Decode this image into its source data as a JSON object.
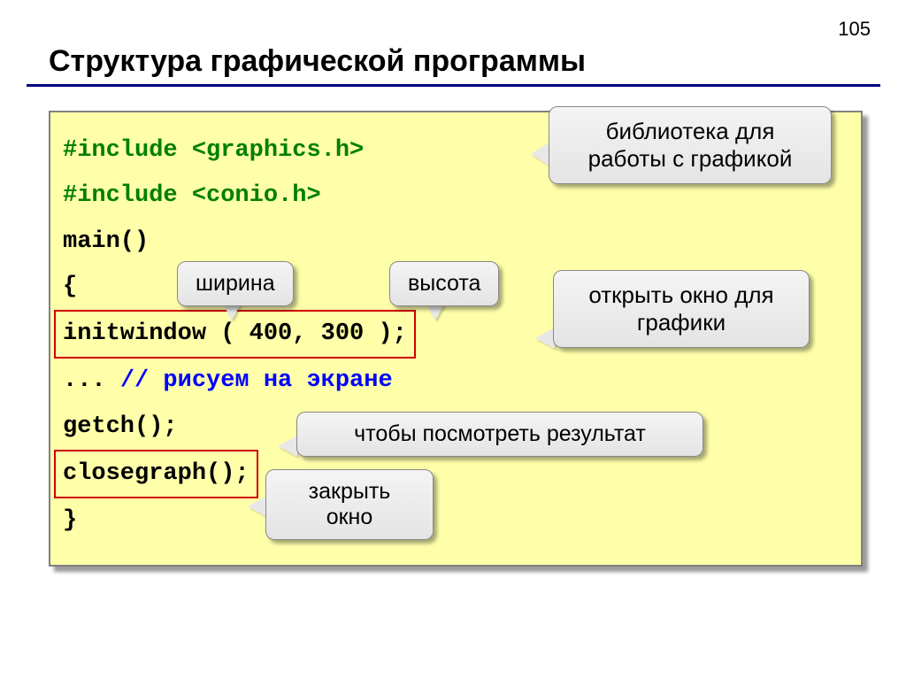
{
  "page_number": "105",
  "title": "Структура графической программы",
  "code": {
    "line1a": "#include ",
    "line1b": "<graphics.h>",
    "line2a": "#include ",
    "line2b": "<conio.h>",
    "line3": "main()",
    "line4": "{",
    "line5": "initwindow ( 400, 300 );",
    "line6a": "... ",
    "line6b": "// рисуем на экране",
    "line7": "getch();",
    "line8": "closegraph();",
    "line9": "}"
  },
  "callouts": {
    "library": "библиотека для работы с графикой",
    "width": "ширина",
    "height": "высота",
    "open_window": "открыть окно для графики",
    "see_result": "чтобы посмотреть результат",
    "close_window": "закрыть окно"
  }
}
